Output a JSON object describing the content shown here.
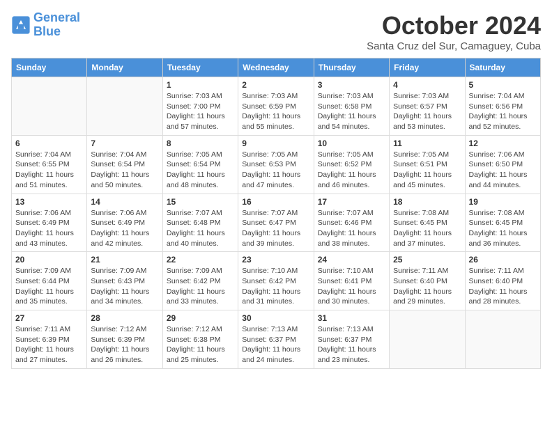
{
  "logo": {
    "line1": "General",
    "line2": "Blue"
  },
  "title": "October 2024",
  "location": "Santa Cruz del Sur, Camaguey, Cuba",
  "days_of_week": [
    "Sunday",
    "Monday",
    "Tuesday",
    "Wednesday",
    "Thursday",
    "Friday",
    "Saturday"
  ],
  "weeks": [
    [
      {
        "day": "",
        "info": ""
      },
      {
        "day": "",
        "info": ""
      },
      {
        "day": "1",
        "info": "Sunrise: 7:03 AM\nSunset: 7:00 PM\nDaylight: 11 hours and 57 minutes."
      },
      {
        "day": "2",
        "info": "Sunrise: 7:03 AM\nSunset: 6:59 PM\nDaylight: 11 hours and 55 minutes."
      },
      {
        "day": "3",
        "info": "Sunrise: 7:03 AM\nSunset: 6:58 PM\nDaylight: 11 hours and 54 minutes."
      },
      {
        "day": "4",
        "info": "Sunrise: 7:03 AM\nSunset: 6:57 PM\nDaylight: 11 hours and 53 minutes."
      },
      {
        "day": "5",
        "info": "Sunrise: 7:04 AM\nSunset: 6:56 PM\nDaylight: 11 hours and 52 minutes."
      }
    ],
    [
      {
        "day": "6",
        "info": "Sunrise: 7:04 AM\nSunset: 6:55 PM\nDaylight: 11 hours and 51 minutes."
      },
      {
        "day": "7",
        "info": "Sunrise: 7:04 AM\nSunset: 6:54 PM\nDaylight: 11 hours and 50 minutes."
      },
      {
        "day": "8",
        "info": "Sunrise: 7:05 AM\nSunset: 6:54 PM\nDaylight: 11 hours and 48 minutes."
      },
      {
        "day": "9",
        "info": "Sunrise: 7:05 AM\nSunset: 6:53 PM\nDaylight: 11 hours and 47 minutes."
      },
      {
        "day": "10",
        "info": "Sunrise: 7:05 AM\nSunset: 6:52 PM\nDaylight: 11 hours and 46 minutes."
      },
      {
        "day": "11",
        "info": "Sunrise: 7:05 AM\nSunset: 6:51 PM\nDaylight: 11 hours and 45 minutes."
      },
      {
        "day": "12",
        "info": "Sunrise: 7:06 AM\nSunset: 6:50 PM\nDaylight: 11 hours and 44 minutes."
      }
    ],
    [
      {
        "day": "13",
        "info": "Sunrise: 7:06 AM\nSunset: 6:49 PM\nDaylight: 11 hours and 43 minutes."
      },
      {
        "day": "14",
        "info": "Sunrise: 7:06 AM\nSunset: 6:49 PM\nDaylight: 11 hours and 42 minutes."
      },
      {
        "day": "15",
        "info": "Sunrise: 7:07 AM\nSunset: 6:48 PM\nDaylight: 11 hours and 40 minutes."
      },
      {
        "day": "16",
        "info": "Sunrise: 7:07 AM\nSunset: 6:47 PM\nDaylight: 11 hours and 39 minutes."
      },
      {
        "day": "17",
        "info": "Sunrise: 7:07 AM\nSunset: 6:46 PM\nDaylight: 11 hours and 38 minutes."
      },
      {
        "day": "18",
        "info": "Sunrise: 7:08 AM\nSunset: 6:45 PM\nDaylight: 11 hours and 37 minutes."
      },
      {
        "day": "19",
        "info": "Sunrise: 7:08 AM\nSunset: 6:45 PM\nDaylight: 11 hours and 36 minutes."
      }
    ],
    [
      {
        "day": "20",
        "info": "Sunrise: 7:09 AM\nSunset: 6:44 PM\nDaylight: 11 hours and 35 minutes."
      },
      {
        "day": "21",
        "info": "Sunrise: 7:09 AM\nSunset: 6:43 PM\nDaylight: 11 hours and 34 minutes."
      },
      {
        "day": "22",
        "info": "Sunrise: 7:09 AM\nSunset: 6:42 PM\nDaylight: 11 hours and 33 minutes."
      },
      {
        "day": "23",
        "info": "Sunrise: 7:10 AM\nSunset: 6:42 PM\nDaylight: 11 hours and 31 minutes."
      },
      {
        "day": "24",
        "info": "Sunrise: 7:10 AM\nSunset: 6:41 PM\nDaylight: 11 hours and 30 minutes."
      },
      {
        "day": "25",
        "info": "Sunrise: 7:11 AM\nSunset: 6:40 PM\nDaylight: 11 hours and 29 minutes."
      },
      {
        "day": "26",
        "info": "Sunrise: 7:11 AM\nSunset: 6:40 PM\nDaylight: 11 hours and 28 minutes."
      }
    ],
    [
      {
        "day": "27",
        "info": "Sunrise: 7:11 AM\nSunset: 6:39 PM\nDaylight: 11 hours and 27 minutes."
      },
      {
        "day": "28",
        "info": "Sunrise: 7:12 AM\nSunset: 6:39 PM\nDaylight: 11 hours and 26 minutes."
      },
      {
        "day": "29",
        "info": "Sunrise: 7:12 AM\nSunset: 6:38 PM\nDaylight: 11 hours and 25 minutes."
      },
      {
        "day": "30",
        "info": "Sunrise: 7:13 AM\nSunset: 6:37 PM\nDaylight: 11 hours and 24 minutes."
      },
      {
        "day": "31",
        "info": "Sunrise: 7:13 AM\nSunset: 6:37 PM\nDaylight: 11 hours and 23 minutes."
      },
      {
        "day": "",
        "info": ""
      },
      {
        "day": "",
        "info": ""
      }
    ]
  ]
}
